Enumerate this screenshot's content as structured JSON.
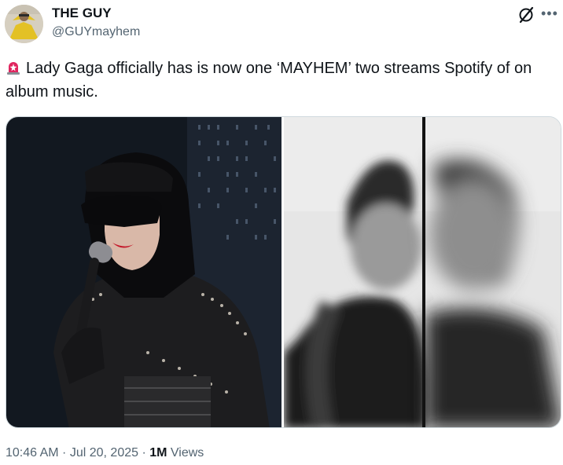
{
  "author": {
    "name": "THE GUY",
    "handle": "@GUYmayhem"
  },
  "tweet": {
    "text": "Lady Gaga officially has is now one ‘MAYHEM’ two streams Spotify of on album music."
  },
  "meta": {
    "time": "10:46 AM",
    "sep1": " · ",
    "date": "Jul 20, 2025",
    "sep2": " · ",
    "views_count": "1M",
    "views_label": " Views"
  },
  "icons": {
    "siren": "police-siren-icon",
    "grok": "grok-icon",
    "more": "more-icon"
  },
  "colors": {
    "text": "#0f1419",
    "secondary": "#536471",
    "border": "#cfd9de"
  }
}
